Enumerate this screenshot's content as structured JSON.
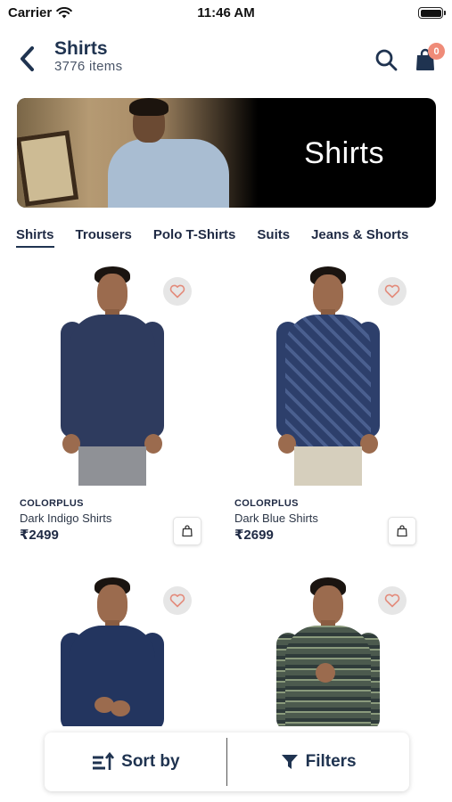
{
  "status_bar": {
    "carrier": "Carrier",
    "time": "11:46 AM"
  },
  "header": {
    "title": "Shirts",
    "subtitle": "3776 items",
    "cart_count": "0"
  },
  "banner": {
    "title": "Shirts"
  },
  "tabs": [
    {
      "label": "Shirts",
      "active": true
    },
    {
      "label": "Trousers",
      "active": false
    },
    {
      "label": "Polo T-Shirts",
      "active": false
    },
    {
      "label": "Suits",
      "active": false
    },
    {
      "label": "Jeans & Shorts",
      "active": false
    }
  ],
  "products": [
    {
      "brand": "COLORPLUS",
      "name": "Dark Indigo Shirts",
      "price": "₹2499",
      "shirt_color": "#2e3b5e"
    },
    {
      "brand": "COLORPLUS",
      "name": "Dark Blue Shirts",
      "price": "₹2699",
      "shirt_color": "#2d3f6b"
    },
    {
      "brand": "",
      "name": "",
      "price": "",
      "shirt_color": "#23355f"
    },
    {
      "brand": "",
      "name": "",
      "price": "",
      "shirt_color": "#4c5a4e"
    }
  ],
  "bottom_bar": {
    "sort_label": "Sort by",
    "filter_label": "Filters"
  },
  "colors": {
    "accent": "#1f3350",
    "badge": "#ef8b78",
    "heart": "#e38a7a"
  },
  "icons": {
    "back": "chevron-left-icon",
    "search": "search-icon",
    "cart": "shopping-bag-icon",
    "wishlist": "heart-icon",
    "add_to_cart": "bag-icon",
    "sort": "sort-icon",
    "filter": "filter-icon"
  }
}
